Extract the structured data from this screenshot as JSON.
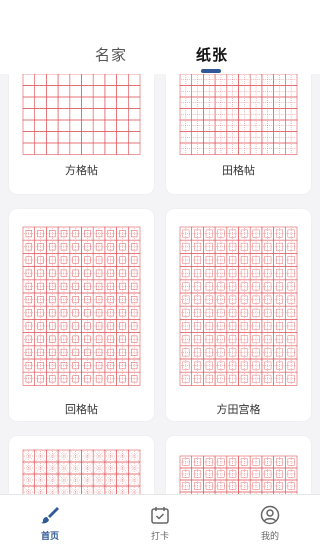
{
  "tabs": [
    {
      "label": "名家",
      "active": false
    },
    {
      "label": "纸张",
      "active": true
    }
  ],
  "cards": [
    {
      "label": "方格帖",
      "style": "square"
    },
    {
      "label": "田格帖",
      "style": "tian"
    },
    {
      "label": "回格帖",
      "style": "hui"
    },
    {
      "label": "方田宫格",
      "style": "fangtiangong"
    },
    {
      "label": "",
      "style": "mi"
    },
    {
      "label": "",
      "style": "fangtiangong"
    }
  ],
  "nav": [
    {
      "label": "首页",
      "icon": "brush-icon",
      "active": true
    },
    {
      "label": "打卡",
      "icon": "calendar-check-icon",
      "active": false
    },
    {
      "label": "我的",
      "icon": "user-icon",
      "active": false
    }
  ],
  "colors": {
    "accent": "#2f5a97",
    "grid_red": "#e0565a",
    "background": "#f4f4f6"
  }
}
